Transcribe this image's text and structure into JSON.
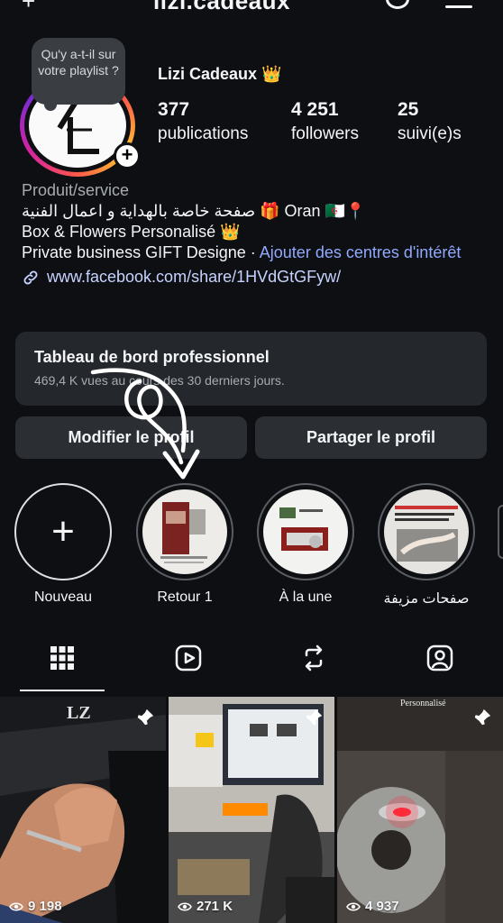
{
  "header": {
    "title": "lizi.cadeaux"
  },
  "note": {
    "text": "Qu'y a-t-il sur votre playlist ?"
  },
  "profile": {
    "name": "Lizi Cadeaux 👑",
    "stats": [
      {
        "value": "377",
        "label": "publications"
      },
      {
        "value": "4 251",
        "label": "followers"
      },
      {
        "value": "25",
        "label": "suivi(e)s"
      }
    ]
  },
  "bio": {
    "category": "Produit/service",
    "line1": "📍Oran 🇩🇿 🎁 صفحة خاصة بالهداية و اعمال الفنية",
    "line2": "Box & Flowers Personalisé 👑",
    "line3": "Private business GIFT Designe · ",
    "interests_link": "Ajouter des centres d'intérêt",
    "url": "www.facebook.com/share/1HVdGtGFyw/"
  },
  "dashboard": {
    "title": "Tableau de bord professionnel",
    "subtitle": "469,4 K vues au cours des 30 derniers jours."
  },
  "actions": {
    "edit": "Modifier le profil",
    "share": "Partager le profil"
  },
  "highlights": [
    {
      "label": "Nouveau"
    },
    {
      "label": "Retour 1"
    },
    {
      "label": "À la une"
    },
    {
      "label": "صفحات مزيفة"
    }
  ],
  "posts": [
    {
      "views": "9 198"
    },
    {
      "views": "271 K"
    },
    {
      "views": "4 937",
      "caption": "Personnalisé"
    }
  ],
  "colors": {
    "background": "#0d0f12",
    "card": "#24272c",
    "button": "#2b2e33",
    "link": "#91a9ff"
  }
}
